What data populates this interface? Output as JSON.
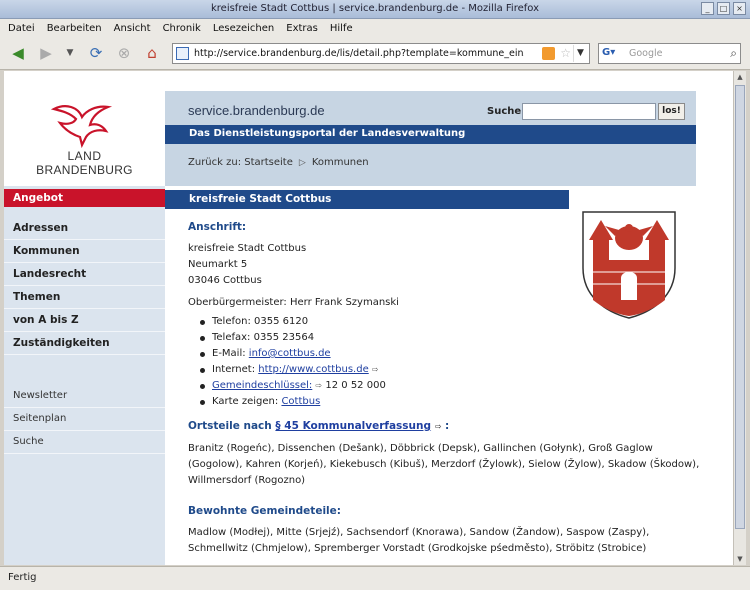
{
  "window": {
    "title": "kreisfreie Stadt Cottbus | service.brandenburg.de - Mozilla Firefox"
  },
  "menu": [
    "Datei",
    "Bearbeiten",
    "Ansicht",
    "Chronik",
    "Lesezeichen",
    "Extras",
    "Hilfe"
  ],
  "urlbar": {
    "url": "http://service.brandenburg.de/lis/detail.php?template=kommune_einzeln_d&id"
  },
  "searchbar": {
    "placeholder": "Google"
  },
  "status": "Fertig",
  "page": {
    "logo": {
      "line1": "LAND",
      "line2": "BRANDENBURG"
    },
    "site_name": "service.brandenburg.de",
    "search": {
      "label": "Suche",
      "button": "los!"
    },
    "portal_title": "Das Dienstleistungsportal der Landesverwaltung",
    "breadcrumb": {
      "back": "Zurück zu: Startseite",
      "current": "Kommunen"
    },
    "sidebar": {
      "header": "Angebot",
      "items": [
        "Adressen",
        "Kommunen",
        "Landesrecht",
        "Themen",
        "von A bis Z",
        "Zuständigkeiten"
      ],
      "secondary": [
        "Newsletter",
        "Seitenplan",
        "Suche"
      ]
    },
    "title": "kreisfreie Stadt Cottbus",
    "address": {
      "heading": "Anschrift:",
      "line1": "kreisfreie Stadt Cottbus",
      "line2": "Neumarkt 5",
      "line3": "03046 Cottbus",
      "mayor": "Oberbürgermeister: Herr Frank Szymanski"
    },
    "contacts": {
      "phone_label": "Telefon:",
      "phone": "0355 6120",
      "fax_label": "Telefax:",
      "fax": "0355 23564",
      "email_label": "E-Mail:",
      "email": "info@cottbus.de",
      "web_label": "Internet:",
      "web": "http://www.cottbus.de",
      "key_label": "Gemeindeschlüssel:",
      "key": "12 0 52 000",
      "map_label": "Karte zeigen:",
      "map": "Cottbus"
    },
    "ortsteile": {
      "heading_prefix": "Ortsteile nach",
      "heading_link": "§ 45 Kommunalverfassung",
      "heading_suffix": ":",
      "text": "Branitz (Rogeńc), Dissenchen (Dešank), Döbbrick (Depsk), Gallinchen (Gołynk), Groß Gaglow (Gogolow), Kahren (Korjeń), Kiekebusch (Kibuš), Merzdorf (Žylowk), Sielow (Žylow), Skadow (Škodow), Willmersdorf (Rogozno)"
    },
    "gemeindeteile": {
      "heading": "Bewohnte Gemeindeteile:",
      "text": "Madlow (Modłej), Mitte (Srjejź), Sachsendorf (Knorawa), Sandow (Žandow), Saspow (Zaspy), Schmellwitz (Chmjelow), Spremberger Vorstadt (Grodkojske pśedměsto), Ströbitz (Strobice)"
    },
    "colors": {
      "accent_blue": "#1f4a8a",
      "accent_red": "#c9132a",
      "header_bg": "#c7d5e3",
      "sidebar_bg": "#dbe4ee"
    }
  }
}
